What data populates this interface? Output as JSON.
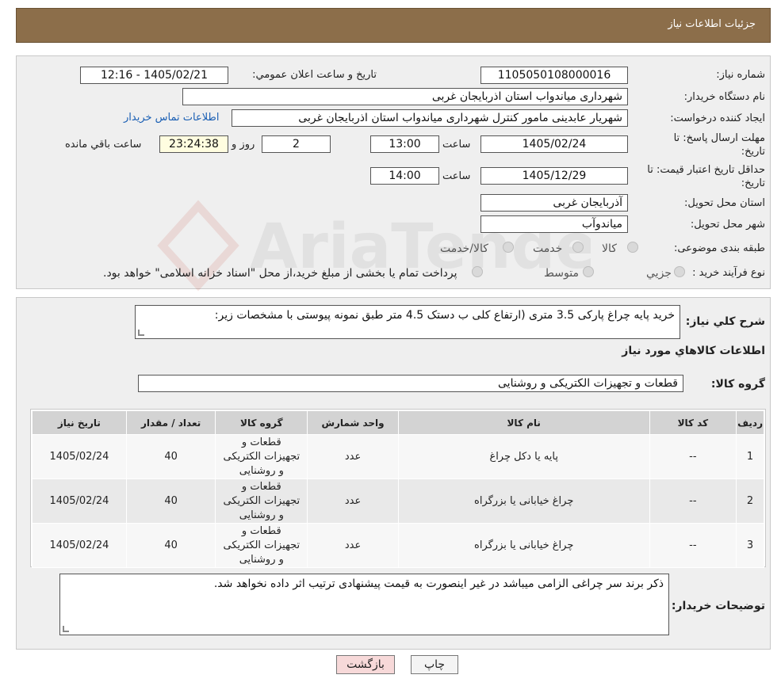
{
  "header": {
    "title": "جزئیات اطلاعات نیاز"
  },
  "watermark": {
    "text": "AriaTender.neT"
  },
  "form": {
    "need_number_label": "شماره نیاز:",
    "need_number": "1105050108000016",
    "announce_label": "تاریخ و ساعت اعلان عمومي:",
    "announce_value": "1405/02/21 - 12:16",
    "buyer_org_label": "نام دستگاه خريدار:",
    "buyer_org": "شهرداری میاندواب استان اذربایجان غربی",
    "creator_label": "ايجاد کننده درخواست:",
    "creator": "شهریار  عابدینی مامور کنترل شهرداری میاندواب استان اذربایجان غربی",
    "contact_link": "اطلاعات تماس خريدار",
    "deadline_label_1": "مهلت ارسال پاسخ: تا",
    "deadline_label_2": "تاريخ:",
    "deadline_date": "1405/02/24",
    "time_word": "ساعت",
    "deadline_time": "13:00",
    "days_value": "2",
    "days_word": "روز و",
    "remaining_time": "23:24:38",
    "remaining_word": "ساعت باقي مانده",
    "validity_label_1": "حداقل تاريخ اعتبار قيمت: تا",
    "validity_label_2": "تاريخ:",
    "validity_date": "1405/12/29",
    "validity_time": "14:00",
    "province_label": "استان محل تحويل:",
    "province": "آذربایجان غربی",
    "city_label": "شهر محل تحويل:",
    "city": "میاندوآب",
    "category_label": "طبقه بندی موضوعی:",
    "category_options": [
      "کالا",
      "خدمت",
      "کالا/خدمت"
    ],
    "process_label": "نوع فرآيند خريد :",
    "process_options": [
      "جزيي",
      "متوسط"
    ],
    "process_note": "پرداخت تمام یا بخشی از مبلغ خرید،از محل \"اسناد خزانه اسلامی\" خواهد بود."
  },
  "summary": {
    "label": "شرح کلي نياز:",
    "text": "خرید پایه چراغ پارکی 3.5 متری (ارتفاع کلی ب دستک 4.5 متر طبق نمونه پیوستی با مشخصات زیر:",
    "goods_info_title": "اطلاعات کالاهاي مورد نياز",
    "group_label": "گروه کالا:",
    "group_value": "قطعات و تجهیزات الکتریکی و روشنایی"
  },
  "table": {
    "headers": [
      "رديف",
      "کد کالا",
      "نام کالا",
      "واحد شمارش",
      "گروه کالا",
      "تعداد / مقدار",
      "تاريخ نياز"
    ],
    "rows": [
      [
        "1",
        "--",
        "پایه یا دکل چراغ",
        "عدد",
        "قطعات و تجهیزات الکتریکی و روشنایی",
        "40",
        "1405/02/24"
      ],
      [
        "2",
        "--",
        "چراغ خیابانی یا بزرگراه",
        "عدد",
        "قطعات و تجهیزات الکتریکی و روشنایی",
        "40",
        "1405/02/24"
      ],
      [
        "3",
        "--",
        "چراغ خیابانی یا بزرگراه",
        "عدد",
        "قطعات و تجهیزات الکتریکی و روشنایی",
        "40",
        "1405/02/24"
      ]
    ]
  },
  "buyer_notes": {
    "label": "توضيحات خريدار:",
    "text": "ذکر برند سر چراغی الزامی میباشد در غیر اینصورت به قیمت پیشنهادی ترتیب اثر داده نخواهد شد."
  },
  "buttons": {
    "print": "چاپ",
    "back": "بازگشت"
  },
  "colors": {
    "header_bg": "#8c6e4a",
    "back_button_bg": "#f7d9d9",
    "remaining_bg": "#fffde0"
  }
}
